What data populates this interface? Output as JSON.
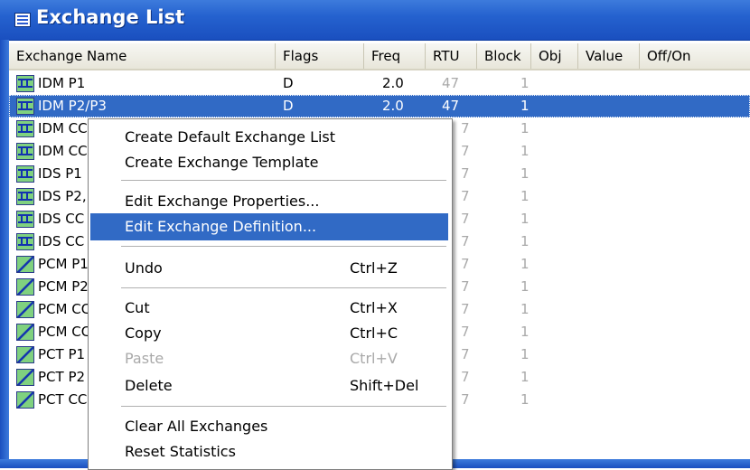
{
  "window": {
    "title": "Exchange List"
  },
  "columns": [
    "Exchange Name",
    "Flags",
    "Freq",
    "RTU",
    "Block",
    "Obj",
    "Value",
    "Off/On"
  ],
  "rows": [
    {
      "name": "IDM P1",
      "icon": "idm-exchange-icon",
      "flags": "D",
      "freq": "2.0",
      "rtu": "47",
      "block": "1"
    },
    {
      "name": "IDM P2/P3",
      "icon": "idm-exchange-icon",
      "flags": "D",
      "freq": "2.0",
      "rtu": "47",
      "block": "1",
      "selected": true
    },
    {
      "name": "IDM CC",
      "icon": "idm-exchange-icon",
      "rtu": "7",
      "block": "1"
    },
    {
      "name": "IDM CC",
      "icon": "idm-exchange-icon",
      "rtu": "7",
      "block": "1"
    },
    {
      "name": "IDS P1",
      "icon": "idm-exchange-icon",
      "rtu": "7",
      "block": "1"
    },
    {
      "name": "IDS P2,",
      "icon": "idm-exchange-icon",
      "rtu": "7",
      "block": "1"
    },
    {
      "name": "IDS CC",
      "icon": "idm-exchange-icon",
      "rtu": "7",
      "block": "1"
    },
    {
      "name": "IDS CC",
      "icon": "idm-exchange-icon",
      "rtu": "7",
      "block": "1"
    },
    {
      "name": "PCM P1",
      "icon": "pcm-exchange-icon",
      "rtu": "7",
      "block": "1"
    },
    {
      "name": "PCM P2",
      "icon": "pcm-exchange-icon",
      "rtu": "7",
      "block": "1"
    },
    {
      "name": "PCM CC",
      "icon": "pcm-exchange-icon",
      "rtu": "7",
      "block": "1"
    },
    {
      "name": "PCM CC",
      "icon": "pcm-exchange-icon",
      "rtu": "7",
      "block": "1"
    },
    {
      "name": "PCT P1",
      "icon": "pcm-exchange-icon",
      "rtu": "7",
      "block": "1"
    },
    {
      "name": "PCT P2",
      "icon": "pcm-exchange-icon",
      "rtu": "7",
      "block": "1"
    },
    {
      "name": "PCT CC",
      "icon": "pcm-exchange-icon",
      "rtu": "7",
      "block": "1"
    }
  ],
  "context_menu": {
    "create_default": "Create Default Exchange List",
    "create_template": "Create Exchange Template",
    "edit_properties": "Edit Exchange Properties...",
    "edit_definition": "Edit Exchange Definition...",
    "undo": {
      "label": "Undo",
      "shortcut": "Ctrl+Z"
    },
    "cut": {
      "label": "Cut",
      "shortcut": "Ctrl+X"
    },
    "copy": {
      "label": "Copy",
      "shortcut": "Ctrl+C"
    },
    "paste": {
      "label": "Paste",
      "shortcut": "Ctrl+V"
    },
    "delete": {
      "label": "Delete",
      "shortcut": "Shift+Del"
    },
    "clear_all": "Clear All Exchanges",
    "reset_stats": "Reset Statistics"
  },
  "colors": {
    "selection": "#316ac5",
    "title_bar": "#2562cf"
  }
}
